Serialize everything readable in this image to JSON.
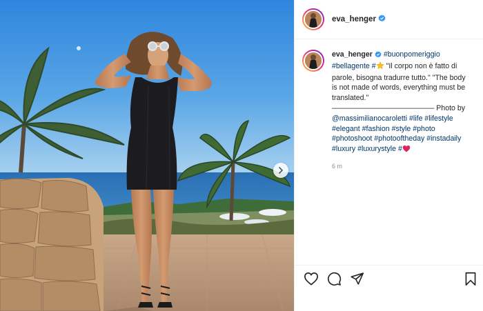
{
  "post": {
    "username": "eva_henger",
    "verified": true,
    "next_label": "Next",
    "caption": {
      "username": "eva_henger",
      "segments": [
        {
          "type": "tag",
          "text": "#buonpomeriggio"
        },
        {
          "type": "text",
          "text": " "
        },
        {
          "type": "tag",
          "text": "#bellagente"
        },
        {
          "type": "text",
          "text": " "
        },
        {
          "type": "tag",
          "text": "#"
        },
        {
          "type": "emoji",
          "icon": "star-emoji"
        },
        {
          "type": "text",
          "text": " \"Il corpo non è fatto di parole, bisogna tradurre tutto.\" \"The body is not made of words, everything must be translated.\" —————————————— Photo by "
        },
        {
          "type": "tag",
          "text": "@massimilianocaroletti"
        },
        {
          "type": "text",
          "text": " "
        },
        {
          "type": "tag",
          "text": "#life"
        },
        {
          "type": "text",
          "text": " "
        },
        {
          "type": "tag",
          "text": "#lifestyle"
        },
        {
          "type": "text",
          "text": " "
        },
        {
          "type": "tag",
          "text": "#elegant"
        },
        {
          "type": "text",
          "text": " "
        },
        {
          "type": "tag",
          "text": "#fashion"
        },
        {
          "type": "text",
          "text": " "
        },
        {
          "type": "tag",
          "text": "#style"
        },
        {
          "type": "text",
          "text": " "
        },
        {
          "type": "tag",
          "text": "#photo"
        },
        {
          "type": "text",
          "text": " "
        },
        {
          "type": "tag",
          "text": "#photoshoot"
        },
        {
          "type": "text",
          "text": " "
        },
        {
          "type": "tag",
          "text": "#photooftheday"
        },
        {
          "type": "text",
          "text": " "
        },
        {
          "type": "tag",
          "text": "#instadaily"
        },
        {
          "type": "text",
          "text": " "
        },
        {
          "type": "tag",
          "text": "#luxury"
        },
        {
          "type": "text",
          "text": " "
        },
        {
          "type": "tag",
          "text": "#luxurystyle"
        },
        {
          "type": "text",
          "text": " "
        },
        {
          "type": "tag",
          "text": "#"
        },
        {
          "type": "emoji",
          "icon": "heart-emoji"
        }
      ],
      "time": "6 m"
    },
    "actions": [
      {
        "name": "like-heart-icon"
      },
      {
        "name": "comment-icon"
      },
      {
        "name": "share-icon"
      },
      {
        "name": "save-bookmark-icon"
      }
    ]
  },
  "colors": {
    "link": "#00376b",
    "meta": "#8e8e8e",
    "verified": "#3897f0"
  }
}
